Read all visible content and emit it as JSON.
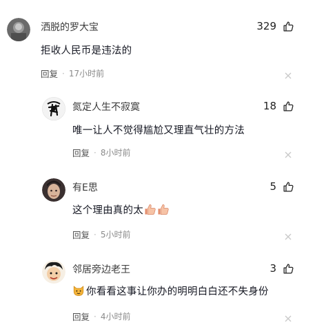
{
  "comments": [
    {
      "author": "洒脱的罗大宝",
      "likes": "329",
      "text": "拒收人民币是违法的",
      "reply_label": "回复",
      "time": "17小时前"
    },
    {
      "author": "氮定人生不寂寞",
      "likes": "18",
      "text": "唯一让人不觉得尴尬又理直气壮的方法",
      "reply_label": "回复",
      "time": "8小时前"
    },
    {
      "author": "有E思",
      "likes": "5",
      "text": "这个理由真的太",
      "emojis": [
        "thumbs-up",
        "thumbs-up"
      ],
      "reply_label": "回复",
      "time": "5小时前"
    },
    {
      "author": "邻居旁边老王",
      "likes": "3",
      "text": "你看看这事让你办的明明白白还不失身份",
      "lead_emoji": "cat-face",
      "reply_label": "回复",
      "time": "4小时前"
    }
  ],
  "separator": "·",
  "icons": {
    "like": "thumbs-up-outline-icon",
    "close": "close-x-icon"
  }
}
